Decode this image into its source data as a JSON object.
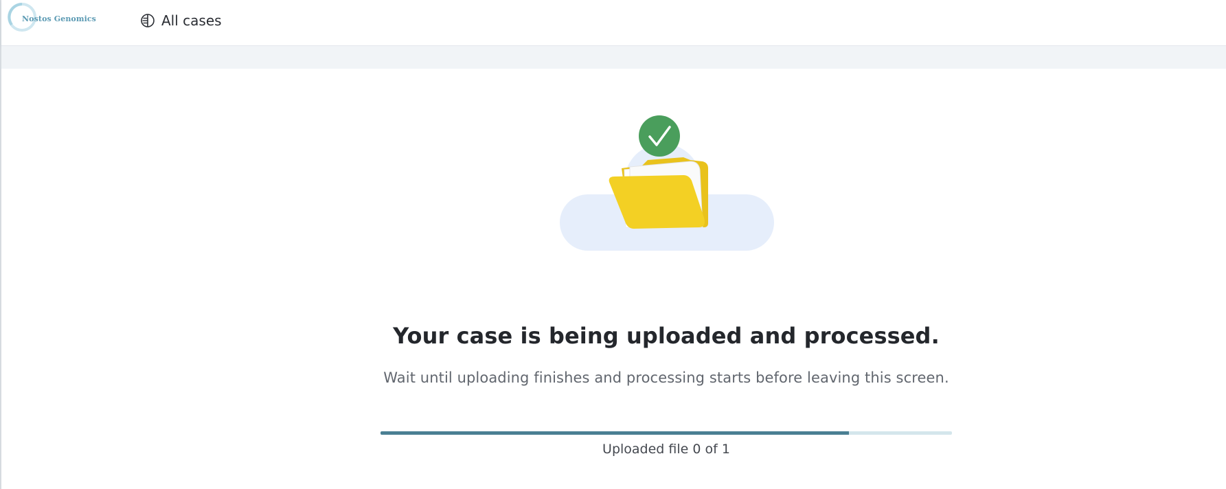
{
  "header": {
    "logo_text": "Nostos Genomics",
    "nav": {
      "all_cases_label": "All cases",
      "icon": "cases-icon"
    }
  },
  "upload": {
    "illustration_icons": [
      "cloud-icon",
      "folder-icon",
      "check-icon"
    ],
    "title": "Your case is being uploaded and processed.",
    "subtitle": "Wait until uploading finishes and processing starts before leaving this screen.",
    "progress": {
      "fraction": 0.82,
      "label": "Uploaded file 0 of 1"
    }
  },
  "colors": {
    "accent": "#4a7f93",
    "check": "#4a9e5c",
    "folder": "#f3d024",
    "cloud": "#e6eefb"
  }
}
